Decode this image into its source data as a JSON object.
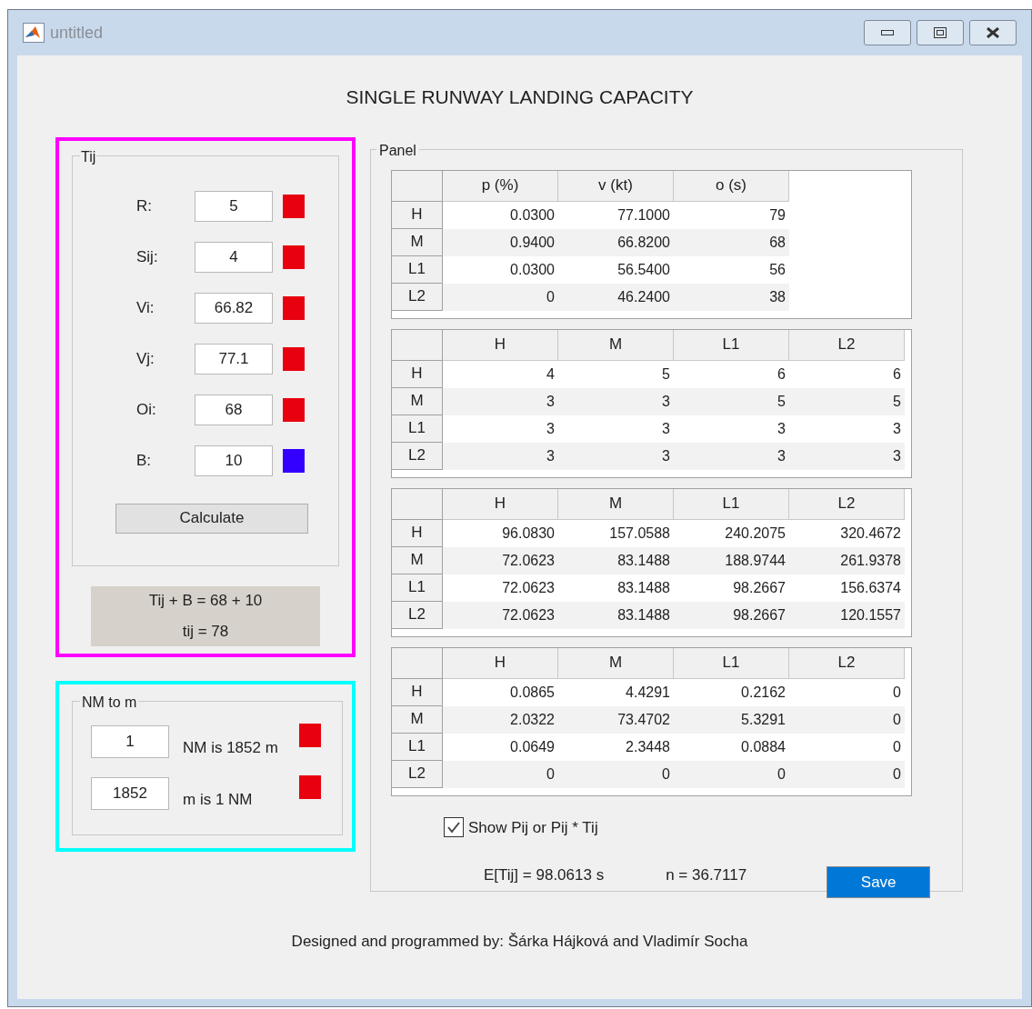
{
  "window": {
    "title": "untitled"
  },
  "heading": "SINGLE RUNWAY LANDING CAPACITY",
  "tij_panel": {
    "title": "Tij",
    "fields": [
      {
        "label": "R:",
        "value": "5",
        "color": "#e8000f"
      },
      {
        "label": "Sij:",
        "value": "4",
        "color": "#e8000f"
      },
      {
        "label": "Vi:",
        "value": "66.82",
        "color": "#e8000f"
      },
      {
        "label": "Vj:",
        "value": "77.1",
        "color": "#e8000f"
      },
      {
        "label": "Oi:",
        "value": "68",
        "color": "#e8000f"
      },
      {
        "label": "B:",
        "value": "10",
        "color": "#3300ff"
      }
    ],
    "calculate_button": "Calculate",
    "result_lines": [
      "Tij + B = 68 + 10",
      "tij = 78"
    ]
  },
  "nm_panel": {
    "title": "NM to m",
    "rows": [
      {
        "value": "1",
        "label": "NM is 1852 m",
        "color": "#e8000f"
      },
      {
        "value": "1852",
        "label": "m is 1 NM",
        "color": "#e8000f"
      }
    ]
  },
  "panel": {
    "title": "Panel",
    "tables": [
      {
        "columns": [
          "p (%)",
          "v (kt)",
          "o (s)"
        ],
        "rows": [
          {
            "header": "H",
            "cells": [
              "0.0300",
              "77.1000",
              "79"
            ]
          },
          {
            "header": "M",
            "cells": [
              "0.9400",
              "66.8200",
              "68"
            ]
          },
          {
            "header": "L1",
            "cells": [
              "0.0300",
              "56.5400",
              "56"
            ]
          },
          {
            "header": "L2",
            "cells": [
              "0",
              "46.2400",
              "38"
            ]
          }
        ]
      },
      {
        "columns": [
          "H",
          "M",
          "L1",
          "L2"
        ],
        "rows": [
          {
            "header": "H",
            "cells": [
              "4",
              "5",
              "6",
              "6"
            ]
          },
          {
            "header": "M",
            "cells": [
              "3",
              "3",
              "5",
              "5"
            ]
          },
          {
            "header": "L1",
            "cells": [
              "3",
              "3",
              "3",
              "3"
            ]
          },
          {
            "header": "L2",
            "cells": [
              "3",
              "3",
              "3",
              "3"
            ]
          }
        ]
      },
      {
        "columns": [
          "H",
          "M",
          "L1",
          "L2"
        ],
        "rows": [
          {
            "header": "H",
            "cells": [
              "96.0830",
              "157.0588",
              "240.2075",
              "320.4672"
            ]
          },
          {
            "header": "M",
            "cells": [
              "72.0623",
              "83.1488",
              "188.9744",
              "261.9378"
            ]
          },
          {
            "header": "L1",
            "cells": [
              "72.0623",
              "83.1488",
              "98.2667",
              "156.6374"
            ]
          },
          {
            "header": "L2",
            "cells": [
              "72.0623",
              "83.1488",
              "98.2667",
              "120.1557"
            ]
          }
        ]
      },
      {
        "columns": [
          "H",
          "M",
          "L1",
          "L2"
        ],
        "rows": [
          {
            "header": "H",
            "cells": [
              "0.0865",
              "4.4291",
              "0.2162",
              "0"
            ]
          },
          {
            "header": "M",
            "cells": [
              "2.0322",
              "73.4702",
              "5.3291",
              "0"
            ]
          },
          {
            "header": "L1",
            "cells": [
              "0.0649",
              "2.3448",
              "0.0884",
              "0"
            ]
          },
          {
            "header": "L2",
            "cells": [
              "0",
              "0",
              "0",
              "0"
            ]
          }
        ]
      }
    ],
    "checkbox": {
      "label": "Show Pij or Pij * Tij",
      "checked": true
    },
    "expected": "E[Tij] = 98.0613 s",
    "n": "n = 36.7117",
    "save_button": "Save"
  },
  "footer": "Designed and programmed by: Šárka Hájková and Vladimír Socha"
}
